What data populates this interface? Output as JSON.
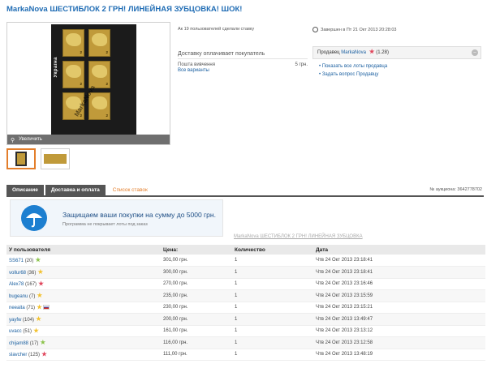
{
  "title": "MarkaNova ШЕСТИБЛОК 2 ГРН! ЛИНЕЙНАЯ ЗУБЦОВКА! ШОК!",
  "photo": {
    "zoom_label": "Увеличить",
    "side_text": "Україна",
    "watermark": "MarkaNova"
  },
  "info": {
    "watchers": "Ак 19 пользователей сделали ставку",
    "delivery_title": "Доставку оплачивает покупатель",
    "delivery_item": "Пошта вивчення",
    "delivery_price": "5 грн.",
    "all_variants": "Все варианты"
  },
  "ends": "Завершен в Пт 21 Окт 2013 20:28:03",
  "seller": {
    "label": "Продавец",
    "name": "MarkaNova",
    "rating": "(1.28)",
    "links": [
      "Показать все лоты продавца",
      "Задать вопрос Продавцу"
    ]
  },
  "tabs": [
    "Описание",
    "Доставка и оплата",
    "Список ставок"
  ],
  "lot_no": "№ аукциона: 3642778702",
  "protect": {
    "main": "Защищаем ваши покупки на сумму до 5000 грн.",
    "sub": "Программа не покрывает лоты под заказ"
  },
  "caption_link": "MarkaNova ШЕСТИБЛОК 2 ГРН! ЛИНЕЙНАЯ ЗУБЦОВКА",
  "colors": {
    "accent": "#1f6cb4",
    "tab_active": "#e37e2b"
  },
  "bids": {
    "headers": [
      "У пользователя",
      "Цена:",
      "Количество",
      "Дата"
    ],
    "rows": [
      {
        "user": "SS671",
        "fb": "(20)",
        "star": "#8bc34a",
        "flag": false,
        "price": "301,00 грн.",
        "qty": "1",
        "date": "Чтв 24 Окт 2013 23:18:41"
      },
      {
        "user": "vollur68",
        "fb": "(36)",
        "star": "#f2c12e",
        "flag": false,
        "price": "300,00 грн.",
        "qty": "1",
        "date": "Чтв 24 Окт 2013 23:18:41"
      },
      {
        "user": "Alex78",
        "fb": "(167)",
        "star": "#e0445a",
        "flag": false,
        "price": "270,00 грн.",
        "qty": "1",
        "date": "Чтв 24 Окт 2013 23:16:46"
      },
      {
        "user": "bugeanu",
        "fb": "(7)",
        "star": "#f2c12e",
        "flag": false,
        "price": "235,00 грн.",
        "qty": "1",
        "date": "Чтв 24 Окт 2013 23:15:59"
      },
      {
        "user": "neeaita",
        "fb": "(71)",
        "star": "#f2c12e",
        "flag": true,
        "price": "230,00 грн.",
        "qty": "1",
        "date": "Чтв 24 Окт 2013 23:15:21"
      },
      {
        "user": "yayfw",
        "fb": "(104)",
        "star": "#f2c12e",
        "flag": false,
        "price": "200,00 грн.",
        "qty": "1",
        "date": "Чтв 24 Окт 2013 13:49:47"
      },
      {
        "user": "uvacc",
        "fb": "(51)",
        "star": "#f2c12e",
        "flag": false,
        "price": "161,00 грн.",
        "qty": "1",
        "date": "Чтв 24 Окт 2013 23:13:12"
      },
      {
        "user": "chijam88",
        "fb": "(17)",
        "star": "#8bc34a",
        "flag": false,
        "price": "116,00 грн.",
        "qty": "1",
        "date": "Чтв 24 Окт 2013 23:12:58"
      },
      {
        "user": "slavcher",
        "fb": "(125)",
        "star": "#e0445a",
        "flag": false,
        "price": "111,00 грн.",
        "qty": "1",
        "date": "Чтв 24 Окт 2013 13:48:19"
      }
    ]
  }
}
